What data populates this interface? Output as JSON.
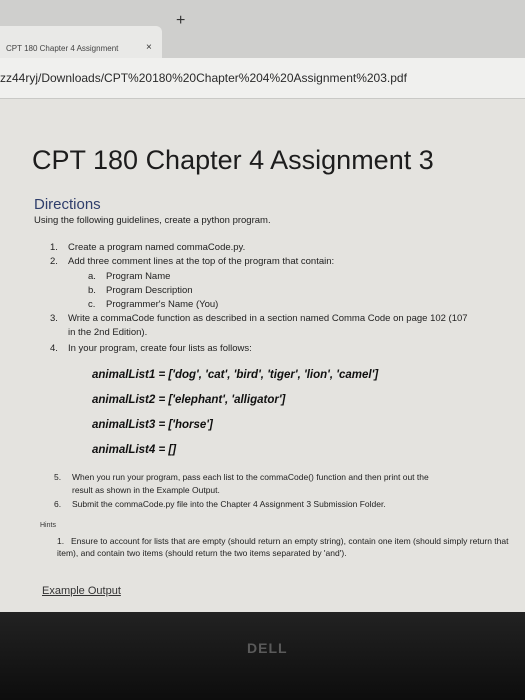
{
  "browser": {
    "tab_title": "CPT 180 Chapter 4 Assignment",
    "close_glyph": "×",
    "new_tab_glyph": "+",
    "url": "zz44ryj/Downloads/CPT%20180%20Chapter%204%20Assignment%203.pdf"
  },
  "document": {
    "title": "CPT 180 Chapter 4 Assignment 3",
    "directions_heading": "Directions",
    "intro": "Using the following guidelines, create a python program.",
    "steps": [
      {
        "num": "1.",
        "text": "Create a program named commaCode.py."
      },
      {
        "num": "2.",
        "text": "Add three comment lines at the top of the program that contain:"
      },
      {
        "num": "a.",
        "text": "Program Name"
      },
      {
        "num": "b.",
        "text": "Program Description"
      },
      {
        "num": "c.",
        "text": "Programmer's Name (You)"
      },
      {
        "num": "3.",
        "text": "Write a commaCode function as described in a section named Comma Code on page 102 (107"
      },
      {
        "num": "",
        "text": "in the 2nd Edition)."
      },
      {
        "num": "4.",
        "text": "In your program, create four lists as follows:"
      },
      {
        "num": "5.",
        "text": "When you run your program, pass each list to the commaCode() function and then print out the"
      },
      {
        "num": "",
        "text": "result as shown in the Example Output."
      },
      {
        "num": "6.",
        "text": "Submit the commaCode.py file into the Chapter 4 Assignment 3 Submission Folder."
      }
    ],
    "lists": [
      "animalList1 = ['dog', 'cat', 'bird', 'tiger', 'lion', 'camel']",
      "animalList2 = ['elephant', 'alligator']",
      "animalList3 = ['horse']",
      "animalList4 = []"
    ],
    "hints_heading": "Hints",
    "hint_num": "1.",
    "hint_text": "Ensure to account for lists that are empty (should return an empty string), contain one item (should simply return that item), and contain two items (should return the two items separated by 'and').",
    "example_heading": "Example Output"
  },
  "bezel": {
    "logo": "DELL"
  }
}
